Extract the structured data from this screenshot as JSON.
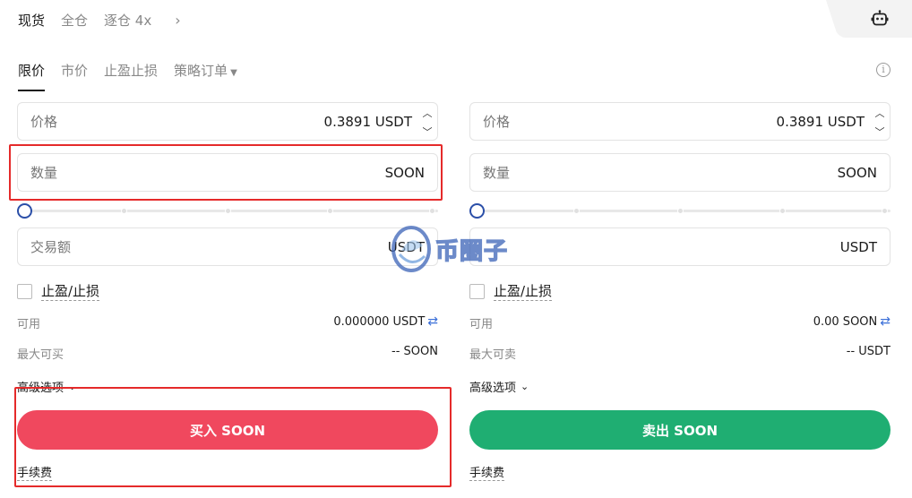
{
  "top_tabs": [
    "现货",
    "全仓",
    "逐仓 4x"
  ],
  "order_tabs": [
    "限价",
    "市价",
    "止盈止损",
    "策略订单"
  ],
  "buy": {
    "price_label": "价格",
    "price_value": "0.3891 USDT",
    "qty_label": "数量",
    "qty_unit": "SOON",
    "amount_label": "交易额",
    "amount_unit": "USDT",
    "tpsl_label": "止盈/止损",
    "avail_label": "可用",
    "avail_value": "0.000000 USDT",
    "max_label": "最大可买",
    "max_value": "-- SOON",
    "advanced_label": "高级选项",
    "button_label": "买入 SOON",
    "fee_label": "手续费"
  },
  "sell": {
    "price_label": "价格",
    "price_value": "0.3891 USDT",
    "qty_label": "数量",
    "qty_unit": "SOON",
    "amount_unit": "USDT",
    "tpsl_label": "止盈/止损",
    "avail_label": "可用",
    "avail_value": "0.00 SOON",
    "max_label": "最大可卖",
    "max_value": "-- USDT",
    "advanced_label": "高级选项",
    "button_label": "卖出 SOON",
    "fee_label": "手续费"
  },
  "watermark": {
    "text": "币圈子"
  },
  "slider": {
    "buy_fraction": 0,
    "sell_fraction": 0
  },
  "colors": {
    "buy": "#f0485e",
    "sell": "#1fae72",
    "highlight": "#e52a2a",
    "slider_knob": "#2b4fa8"
  },
  "icons": {
    "robot": "robot-icon",
    "info": "info-icon",
    "swap": "swap-icon"
  }
}
